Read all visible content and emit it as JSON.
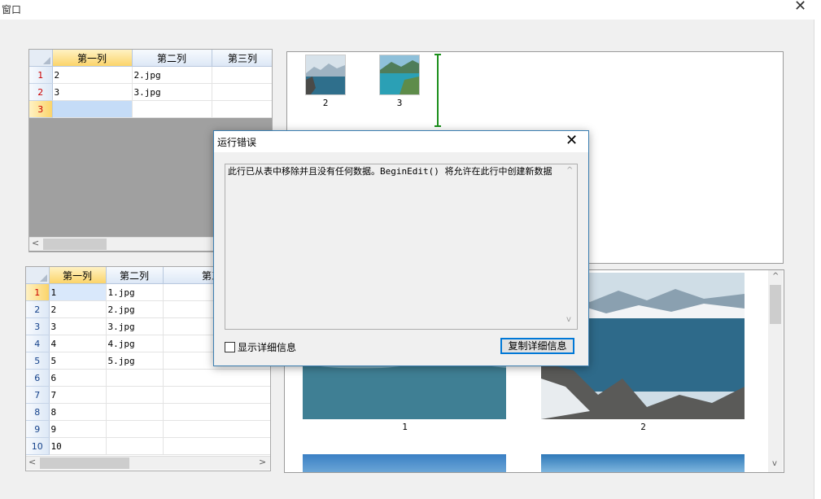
{
  "window": {
    "title": "窗口",
    "close_glyph": "✕"
  },
  "grid1": {
    "columns": [
      "第一列",
      "第二列",
      "第三列"
    ],
    "rows": [
      {
        "num": "1",
        "c1": "2",
        "c2": "2.jpg",
        "c3": ""
      },
      {
        "num": "2",
        "c1": "3",
        "c2": "3.jpg",
        "c3": ""
      },
      {
        "num": "3",
        "c1": "",
        "c2": "",
        "c3": ""
      }
    ],
    "scroll_left": "<"
  },
  "grid2": {
    "columns": [
      "第一列",
      "第二列",
      "第三列"
    ],
    "rows": [
      {
        "num": "1",
        "c1": "1",
        "c2": "1.jpg",
        "c3": ""
      },
      {
        "num": "2",
        "c1": "2",
        "c2": "2.jpg",
        "c3": ""
      },
      {
        "num": "3",
        "c1": "3",
        "c2": "3.jpg",
        "c3": ""
      },
      {
        "num": "4",
        "c1": "4",
        "c2": "4.jpg",
        "c3": ""
      },
      {
        "num": "5",
        "c1": "5",
        "c2": "5.jpg",
        "c3": ""
      },
      {
        "num": "6",
        "c1": "6",
        "c2": "",
        "c3": ""
      },
      {
        "num": "7",
        "c1": "7",
        "c2": "",
        "c3": ""
      },
      {
        "num": "8",
        "c1": "8",
        "c2": "",
        "c3": ""
      },
      {
        "num": "9",
        "c1": "9",
        "c2": "",
        "c3": ""
      },
      {
        "num": "10",
        "c1": "10",
        "c2": "",
        "c3": ""
      }
    ],
    "scroll_left": "<",
    "scroll_right": ">"
  },
  "thumbs_top": [
    {
      "caption": "2"
    },
    {
      "caption": "3"
    }
  ],
  "thumbs_bottom": [
    {
      "caption": "1"
    },
    {
      "caption": "2"
    }
  ],
  "dialog": {
    "title": "运行错误",
    "close_glyph": "✕",
    "message": "此行已从表中移除并且没有任何数据。BeginEdit() 将允许在此行中创建新数据",
    "checkbox_label": "显示详细信息",
    "copy_button": "复制详细信息"
  },
  "icons": {
    "scroll_up": "^",
    "scroll_down": "v"
  }
}
